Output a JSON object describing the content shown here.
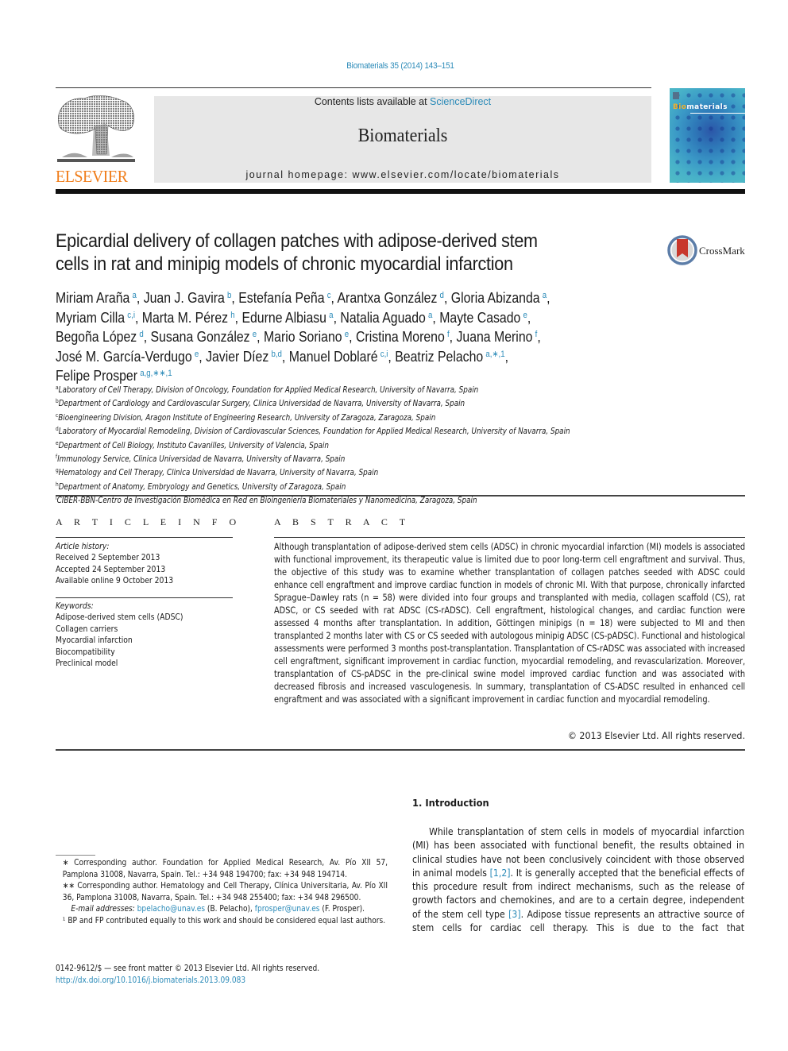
{
  "header": {
    "journal_ref": "Biomaterials 35 (2014) 143–151",
    "publisher_logo_text": "ELSEVIER",
    "contents_prefix": "Contents lists available at ",
    "contents_link": "ScienceDirect",
    "journal_name": "Biomaterials",
    "homepage_line": "journal homepage: www.elsevier.com/locate/biomaterials",
    "cover": {
      "title_bio": "Bio",
      "title_rest": "materials"
    },
    "crossmark_label": "CrossMark"
  },
  "article": {
    "title_lines": [
      "Epicardial delivery of collagen patches with adipose-derived stem",
      "cells in rat and minipig models of chronic myocardial infarction"
    ],
    "author_lines": [
      [
        {
          "name": "Miriam Araña",
          "aff": "a",
          "sep": ", "
        },
        {
          "name": "Juan J. Gavira",
          "aff": "b",
          "sep": ", "
        },
        {
          "name": "Estefanía Peña",
          "aff": "c",
          "sep": ", "
        },
        {
          "name": "Arantxa González",
          "aff": "d",
          "sep": ", "
        },
        {
          "name": "Gloria Abizanda",
          "aff": "a",
          "sep": ","
        }
      ],
      [
        {
          "name": "Myriam Cilla",
          "aff": "c,i",
          "sep": ", "
        },
        {
          "name": "Marta M. Pérez",
          "aff": "h",
          "sep": ", "
        },
        {
          "name": "Edurne Albiasu",
          "aff": "a",
          "sep": ", "
        },
        {
          "name": "Natalia Aguado",
          "aff": "a",
          "sep": ", "
        },
        {
          "name": "Mayte Casado",
          "aff": "e",
          "sep": ","
        }
      ],
      [
        {
          "name": "Begoña López",
          "aff": "d",
          "sep": ", "
        },
        {
          "name": "Susana González",
          "aff": "e",
          "sep": ", "
        },
        {
          "name": "Mario Soriano",
          "aff": "e",
          "sep": ", "
        },
        {
          "name": "Cristina Moreno",
          "aff": "f",
          "sep": ", "
        },
        {
          "name": "Juana Merino",
          "aff": "f",
          "sep": ","
        }
      ],
      [
        {
          "name": "José M. García-Verdugo",
          "aff": "e",
          "sep": ", "
        },
        {
          "name": "Javier Díez",
          "aff": "b,d",
          "sep": ", "
        },
        {
          "name": "Manuel Doblaré",
          "aff": "c,i",
          "sep": ", "
        },
        {
          "name": "Beatriz Pelacho",
          "aff": "a,∗,1",
          "sep": ","
        }
      ],
      [
        {
          "name": "Felipe Prosper",
          "aff": "a,g,∗∗,1",
          "sep": ""
        }
      ]
    ],
    "affiliations": [
      {
        "key": "a",
        "text": "Laboratory of Cell Therapy, Division of Oncology, Foundation for Applied Medical Research, University of Navarra, Spain"
      },
      {
        "key": "b",
        "text": "Department of Cardiology and Cardiovascular Surgery, Clinica Universidad de Navarra, University of Navarra, Spain"
      },
      {
        "key": "c",
        "text": "Bioengineering Division, Aragon Institute of Engineering Research, University of Zaragoza, Zaragoza, Spain"
      },
      {
        "key": "d",
        "text": "Laboratory of Myocardial Remodeling, Division of Cardiovascular Sciences, Foundation for Applied Medical Research, University of Navarra, Spain"
      },
      {
        "key": "e",
        "text": "Department of Cell Biology, Instituto Cavanilles, University of Valencia, Spain"
      },
      {
        "key": "f",
        "text": "Immunology Service, Clinica Universidad de Navarra, University of Navarra, Spain"
      },
      {
        "key": "g",
        "text": "Hematology and Cell Therapy, Clinica Universidad de Navarra, University of Navarra, Spain"
      },
      {
        "key": "h",
        "text": "Department of Anatomy, Embryology and Genetics, University of Zaragoza, Spain"
      },
      {
        "key": "i",
        "text": "CIBER-BBN-Centro de Investigación Biomédica en Red en Bioingeniería Biomateriales y Nanomedicina, Zaragoza, Spain"
      }
    ]
  },
  "article_info": {
    "heading": "A R T I C L E   I N F O",
    "history_label": "Article history:",
    "history": [
      "Received 2 September 2013",
      "Accepted 24 September 2013",
      "Available online 9 October 2013"
    ],
    "keywords_label": "Keywords:",
    "keywords": [
      "Adipose-derived stem cells (ADSC)",
      "Collagen carriers",
      "Myocardial infarction",
      "Biocompatibility",
      "Preclinical model"
    ]
  },
  "abstract": {
    "heading": "A B S T R A C T",
    "text": "Although transplantation of adipose-derived stem cells (ADSC) in chronic myocardial infarction (MI) models is associated with functional improvement, its therapeutic value is limited due to poor long-term cell engraftment and survival. Thus, the objective of this study was to examine whether transplantation of collagen patches seeded with ADSC could enhance cell engraftment and improve cardiac function in models of chronic MI. With that purpose, chronically infarcted Sprague–Dawley rats (n = 58) were divided into four groups and transplanted with media, collagen scaffold (CS), rat ADSC, or CS seeded with rat ADSC (CS-rADSC). Cell engraftment, histological changes, and cardiac function were assessed 4 months after transplantation. In addition, Göttingen minipigs (n = 18) were subjected to MI and then transplanted 2 months later with CS or CS seeded with autologous minipig ADSC (CS-pADSC). Functional and histological assessments were performed 3 months post-transplantation. Transplantation of CS-rADSC was associated with increased cell engraftment, significant improvement in cardiac function, myocardial remodeling, and revascularization. Moreover, transplantation of CS-pADSC in the pre-clinical swine model improved cardiac function and was associated with decreased fibrosis and increased vasculogenesis. In summary, transplantation of CS-ADSC resulted in enhanced cell engraftment and was associated with a significant improvement in cardiac function and myocardial remodeling.",
    "copyright": "© 2013 Elsevier Ltd. All rights reserved."
  },
  "footnotes": {
    "corr1": "∗ Corresponding author. Foundation for Applied Medical Research, Av. Pío XII 57, Pamplona 31008, Navarra, Spain. Tel.: +34 948 194700; fax: +34 948 194714.",
    "corr2": "∗∗ Corresponding author. Hematology and Cell Therapy, Clínica Universitaria, Av. Pío XII 36, Pamplona 31008, Navarra, Spain. Tel.: +34 948 255400; fax: +34 948 296500.",
    "email_label": "E-mail addresses:",
    "email1": "bpelacho@unav.es",
    "email1_name": " (B. Pelacho), ",
    "email2": "fprosper@unav.es",
    "email2_name": " (F. Prosper).",
    "equal": "¹ BP and FP contributed equally to this work and should be considered equal last authors.",
    "front_matter": "0142-9612/$ — see front matter © 2013 Elsevier Ltd. All rights reserved.",
    "doi": "http://dx.doi.org/10.1016/j.biomaterials.2013.09.083"
  },
  "introduction": {
    "heading": "1.  Introduction",
    "p1": "While transplantation of stem cells in models of myocardial infarction (MI) has been associated with functional benefit, the results obtained in clinical studies have not been conclusively coincident with those observed in animal models ",
    "ref1": "[1,2]",
    "p2": ". It is generally accepted that the beneficial effects of this procedure result from indirect mechanisms, such as the release of growth factors and chemokines, and are to a certain degree, independent of the stem cell type ",
    "ref2": "[3]",
    "p3": ". Adipose tissue represents an attractive source of stem cells for cardiac cell therapy. This is due to the fact that"
  },
  "colors": {
    "link": "#2a8ab8",
    "elsevier_orange": "#f07d1a",
    "masthead_gray": "#e7e7e7"
  }
}
